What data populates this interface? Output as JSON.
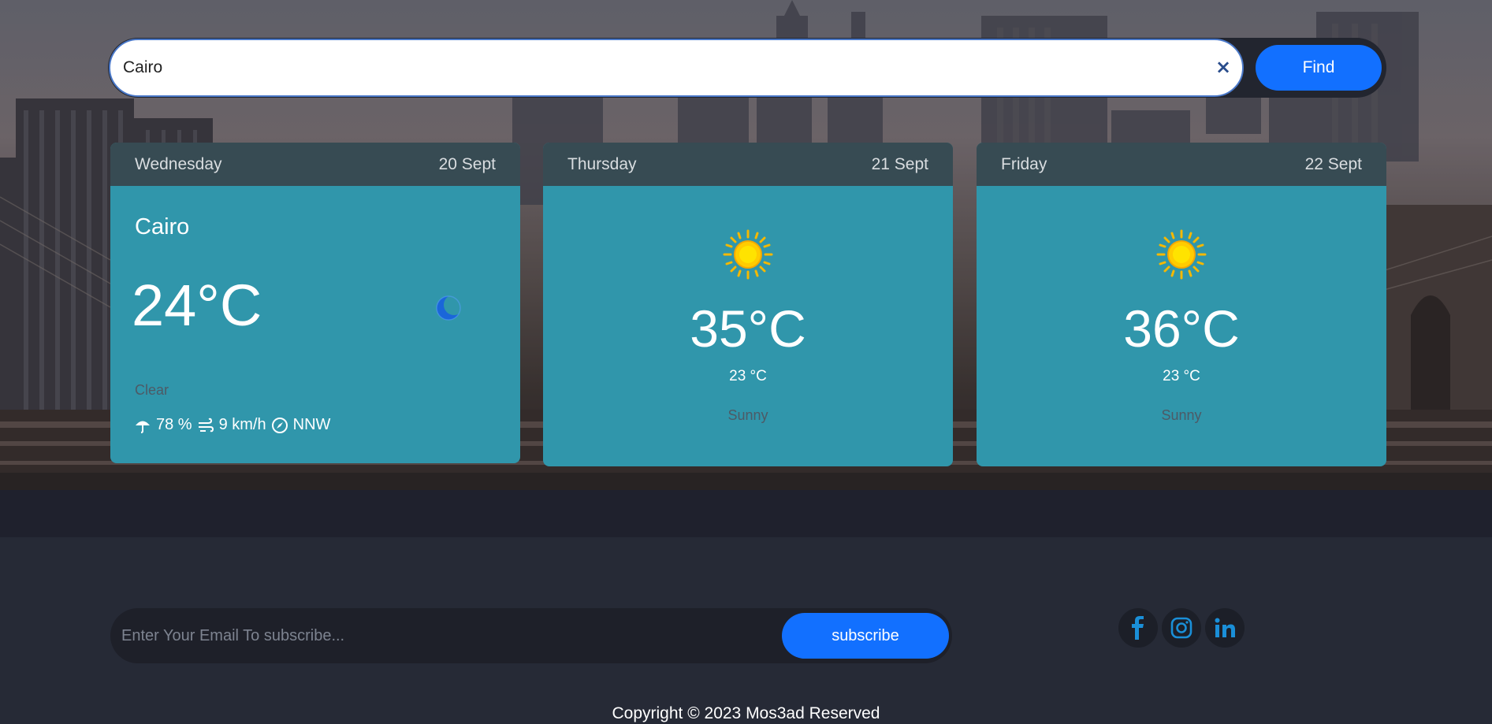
{
  "search": {
    "value": "Cairo",
    "clear_symbol": "×",
    "button_label": "Find"
  },
  "today": {
    "day": "Wednesday",
    "date": "20 Sept",
    "location": "Cairo",
    "temperature": "24°C",
    "icon": "moon-icon",
    "condition": "Clear",
    "humidity": "78 %",
    "wind": "9 km/h",
    "direction": "NNW"
  },
  "forecast": [
    {
      "day": "Thursday",
      "date": "21 Sept",
      "icon": "sun-icon",
      "max": "35°C",
      "min": "23 °C",
      "condition": "Sunny"
    },
    {
      "day": "Friday",
      "date": "22 Sept",
      "icon": "sun-icon",
      "max": "36°C",
      "min": "23 °C",
      "condition": "Sunny"
    }
  ],
  "footer": {
    "subscribe_placeholder": "Enter Your Email To subscribe...",
    "subscribe_label": "subscribe",
    "social": [
      "facebook-icon",
      "instagram-icon",
      "linkedin-icon"
    ],
    "copyright": "Copyright © 2023 Mos3ad Reserved"
  },
  "colors": {
    "accent": "#1270ff",
    "card": "#3096ab",
    "card_header": "#374b53",
    "footer_bg": "#262a36",
    "social_icon": "#1a8fd8"
  }
}
